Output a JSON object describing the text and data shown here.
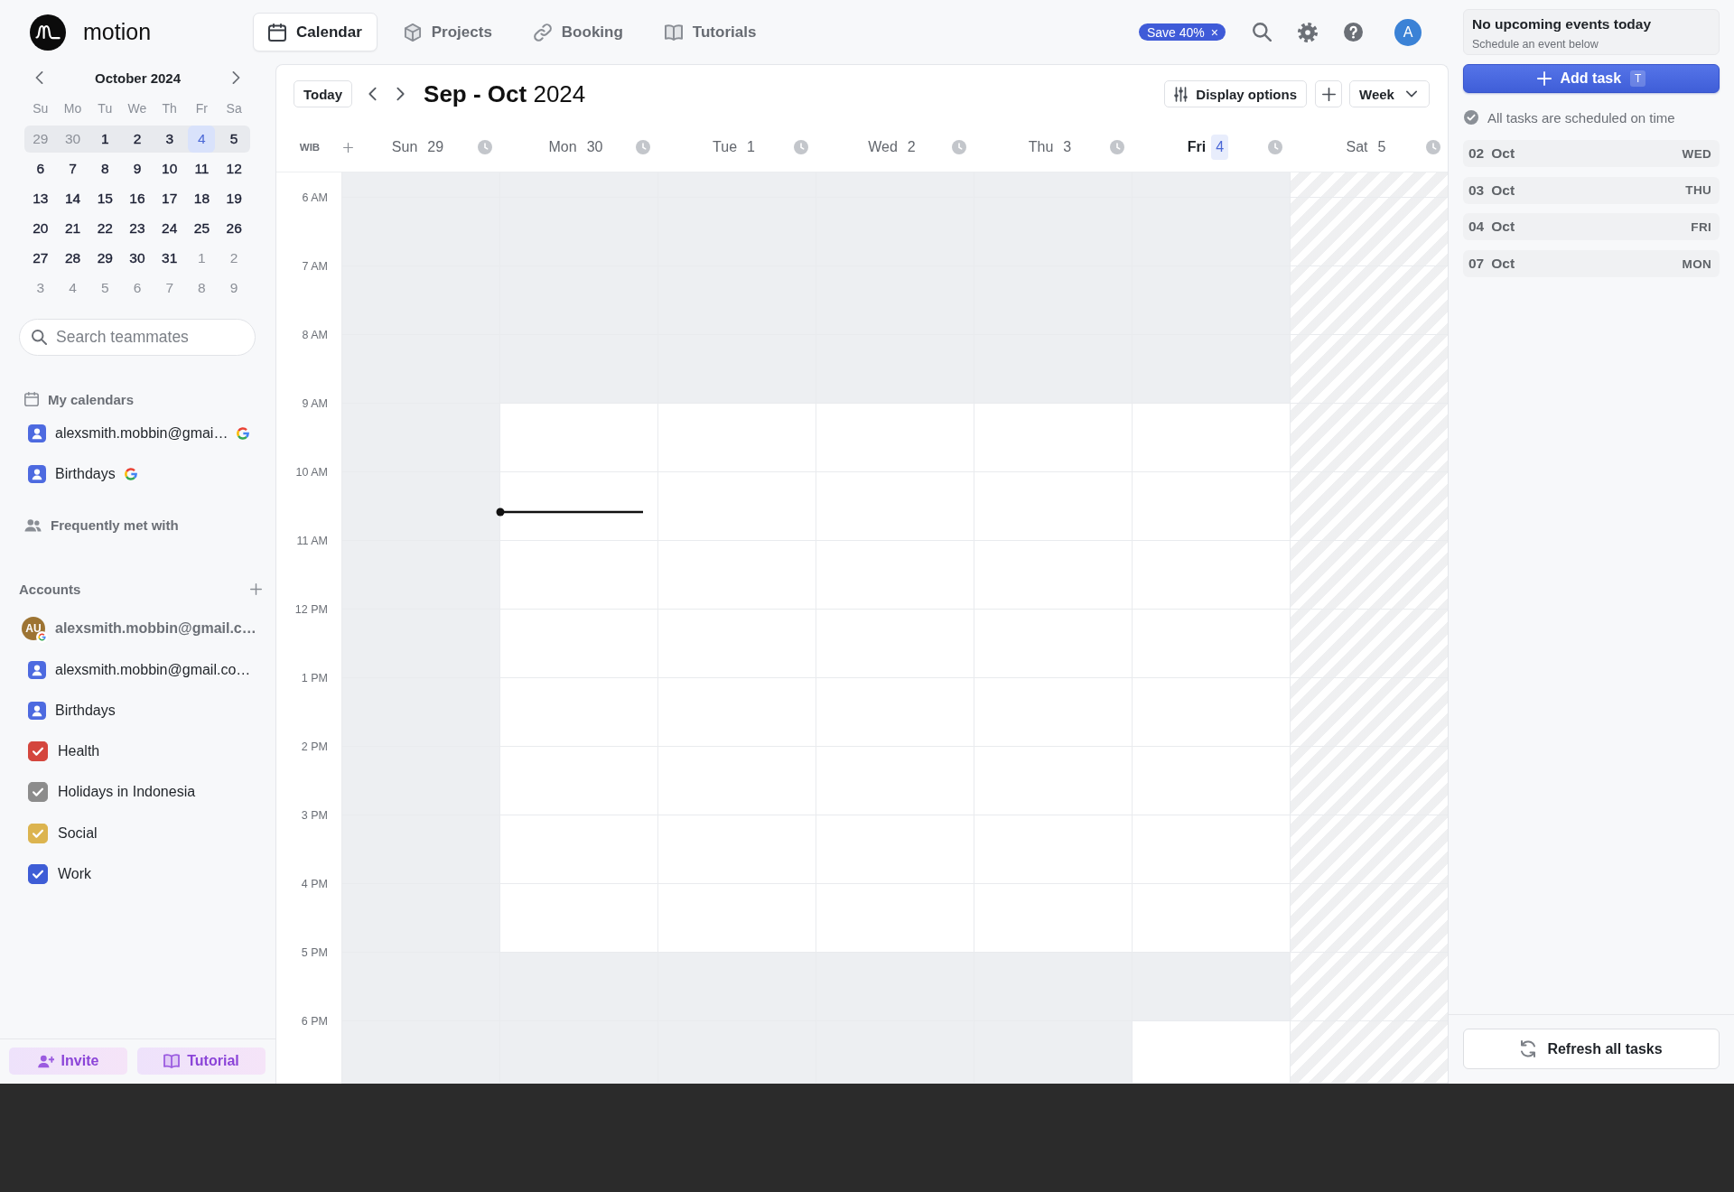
{
  "logo": {
    "name": "motion"
  },
  "nav": {
    "tabs": [
      {
        "label": "Calendar",
        "kind": "calendar",
        "selected": true
      },
      {
        "label": "Projects",
        "kind": "cube",
        "selected": false
      },
      {
        "label": "Booking",
        "kind": "link",
        "selected": false
      },
      {
        "label": "Tutorials",
        "kind": "book",
        "selected": false
      }
    ],
    "promo": {
      "label": "Save 40%",
      "dismiss": "×"
    },
    "avatar": "A"
  },
  "mini_calendar": {
    "title": "October 2024",
    "weekdays": [
      "Su",
      "Mo",
      "Tu",
      "We",
      "Th",
      "Fr",
      "Sa"
    ],
    "weeks": [
      {
        "selected": true,
        "days": [
          {
            "label": "29",
            "muted": true,
            "today": false
          },
          {
            "label": "30",
            "muted": true,
            "today": false
          },
          {
            "label": "1",
            "muted": false,
            "today": false
          },
          {
            "label": "2",
            "muted": false,
            "today": false
          },
          {
            "label": "3",
            "muted": false,
            "today": false
          },
          {
            "label": "4",
            "muted": false,
            "today": true
          },
          {
            "label": "5",
            "muted": false,
            "today": false
          }
        ]
      },
      {
        "selected": false,
        "days": [
          {
            "label": "6",
            "muted": false,
            "today": false
          },
          {
            "label": "7",
            "muted": false,
            "today": false
          },
          {
            "label": "8",
            "muted": false,
            "today": false
          },
          {
            "label": "9",
            "muted": false,
            "today": false
          },
          {
            "label": "10",
            "muted": false,
            "today": false
          },
          {
            "label": "11",
            "muted": false,
            "today": false
          },
          {
            "label": "12",
            "muted": false,
            "today": false
          }
        ]
      },
      {
        "selected": false,
        "days": [
          {
            "label": "13",
            "muted": false,
            "today": false
          },
          {
            "label": "14",
            "muted": false,
            "today": false
          },
          {
            "label": "15",
            "muted": false,
            "today": false
          },
          {
            "label": "16",
            "muted": false,
            "today": false
          },
          {
            "label": "17",
            "muted": false,
            "today": false
          },
          {
            "label": "18",
            "muted": false,
            "today": false
          },
          {
            "label": "19",
            "muted": false,
            "today": false
          }
        ]
      },
      {
        "selected": false,
        "days": [
          {
            "label": "20",
            "muted": false,
            "today": false
          },
          {
            "label": "21",
            "muted": false,
            "today": false
          },
          {
            "label": "22",
            "muted": false,
            "today": false
          },
          {
            "label": "23",
            "muted": false,
            "today": false
          },
          {
            "label": "24",
            "muted": false,
            "today": false
          },
          {
            "label": "25",
            "muted": false,
            "today": false
          },
          {
            "label": "26",
            "muted": false,
            "today": false
          }
        ]
      },
      {
        "selected": false,
        "days": [
          {
            "label": "27",
            "muted": false,
            "today": false
          },
          {
            "label": "28",
            "muted": false,
            "today": false
          },
          {
            "label": "29",
            "muted": false,
            "today": false
          },
          {
            "label": "30",
            "muted": false,
            "today": false
          },
          {
            "label": "31",
            "muted": false,
            "today": false
          },
          {
            "label": "1",
            "muted": true,
            "today": false
          },
          {
            "label": "2",
            "muted": true,
            "today": false
          }
        ]
      },
      {
        "selected": false,
        "days": [
          {
            "label": "3",
            "muted": true,
            "today": false
          },
          {
            "label": "4",
            "muted": true,
            "today": false
          },
          {
            "label": "5",
            "muted": true,
            "today": false
          },
          {
            "label": "6",
            "muted": true,
            "today": false
          },
          {
            "label": "7",
            "muted": true,
            "today": false
          },
          {
            "label": "8",
            "muted": true,
            "today": false
          },
          {
            "label": "9",
            "muted": true,
            "today": false
          }
        ]
      }
    ]
  },
  "teammate_search": {
    "placeholder": "Search teammates"
  },
  "my_calendars": {
    "title": "My calendars",
    "items": [
      {
        "kind": "person",
        "label": "alexsmith.mobbin@gmai…",
        "google": true
      },
      {
        "kind": "person",
        "label": "Birthdays",
        "google": true
      }
    ]
  },
  "frequently_met": {
    "title": "Frequently met with"
  },
  "accounts": {
    "title": "Accounts",
    "items": [
      {
        "kind": "account",
        "initials": "AU",
        "label": "alexsmith.mobbin@gmail.c…",
        "google": true
      },
      {
        "kind": "person",
        "label": "alexsmith.mobbin@gmail.co…",
        "google": false
      },
      {
        "kind": "person",
        "label": "Birthdays",
        "google": false
      },
      {
        "kind": "checkbox",
        "label": "Health",
        "color": "#d4463d",
        "checked": true,
        "google": false
      },
      {
        "kind": "checkbox",
        "label": "Holidays in Indonesia",
        "color": "#8c8c8c",
        "checked": true,
        "google": false
      },
      {
        "kind": "checkbox",
        "label": "Social",
        "color": "#dcb44f",
        "checked": true,
        "google": false
      },
      {
        "kind": "checkbox",
        "label": "Work",
        "color": "#3e5dd6",
        "checked": true,
        "google": false
      }
    ]
  },
  "sidebar_buttons": [
    {
      "label": "Invite",
      "kind": "invite"
    },
    {
      "label": "Tutorial",
      "kind": "tutorial"
    }
  ],
  "calendar": {
    "today_button": "Today",
    "title": "**Sep - Oct** 2024",
    "display_options": "Display options",
    "view": "Week",
    "timezone": "WIB",
    "days": [
      {
        "weekday": "Sun",
        "date": "29",
        "today": false,
        "hatched": false,
        "time_marker": false,
        "shaded": [
          true,
          true,
          true,
          true,
          true,
          true,
          true,
          true,
          true,
          true,
          true,
          true,
          true
        ]
      },
      {
        "weekday": "Mon",
        "date": "30",
        "today": false,
        "hatched": false,
        "time_marker": true,
        "shaded": [
          true,
          true,
          true,
          false,
          false,
          false,
          false,
          false,
          false,
          false,
          false,
          true,
          true
        ]
      },
      {
        "weekday": "Tue",
        "date": "1",
        "today": false,
        "hatched": false,
        "time_marker": false,
        "shaded": [
          true,
          true,
          true,
          false,
          false,
          false,
          false,
          false,
          false,
          false,
          false,
          true,
          true
        ]
      },
      {
        "weekday": "Wed",
        "date": "2",
        "today": false,
        "hatched": false,
        "time_marker": false,
        "shaded": [
          true,
          true,
          true,
          false,
          false,
          false,
          false,
          false,
          false,
          false,
          false,
          true,
          true
        ]
      },
      {
        "weekday": "Thu",
        "date": "3",
        "today": false,
        "hatched": false,
        "time_marker": false,
        "shaded": [
          true,
          true,
          true,
          false,
          false,
          false,
          false,
          false,
          false,
          false,
          false,
          true,
          true
        ]
      },
      {
        "weekday": "Fri",
        "date": "4",
        "today": true,
        "hatched": false,
        "time_marker": false,
        "shaded": [
          true,
          true,
          true,
          false,
          false,
          false,
          false,
          false,
          false,
          false,
          false,
          true,
          false
        ]
      },
      {
        "weekday": "Sat",
        "date": "5",
        "today": false,
        "hatched": true,
        "time_marker": false
      }
    ],
    "hours": [
      {
        "label": "6 AM",
        "time_marker": false
      },
      {
        "label": "7 AM",
        "time_marker": false
      },
      {
        "label": "8 AM",
        "time_marker": false
      },
      {
        "label": "9 AM",
        "time_marker": false
      },
      {
        "label": "10 AM",
        "time_marker": true
      },
      {
        "label": "11 AM",
        "time_marker": false
      },
      {
        "label": "12 PM",
        "time_marker": false
      },
      {
        "label": "1 PM",
        "time_marker": false
      },
      {
        "label": "2 PM",
        "time_marker": false
      },
      {
        "label": "3 PM",
        "time_marker": false
      },
      {
        "label": "4 PM",
        "time_marker": false
      },
      {
        "label": "5 PM",
        "time_marker": false
      },
      {
        "label": "6 PM",
        "time_marker": false
      }
    ]
  },
  "tasks": {
    "notice": {
      "title": "No upcoming events today",
      "subtitle": "Schedule an event below"
    },
    "add_button": {
      "label": "Add task",
      "shortcut": "T"
    },
    "status": "All tasks are scheduled on time",
    "dates": [
      {
        "day": "02",
        "month": "Oct",
        "weekday": "WED"
      },
      {
        "day": "03",
        "month": "Oct",
        "weekday": "THU"
      },
      {
        "day": "04",
        "month": "Oct",
        "weekday": "FRI"
      },
      {
        "day": "07",
        "month": "Oct",
        "weekday": "MON"
      }
    ],
    "refresh_button": "Refresh all tasks"
  }
}
